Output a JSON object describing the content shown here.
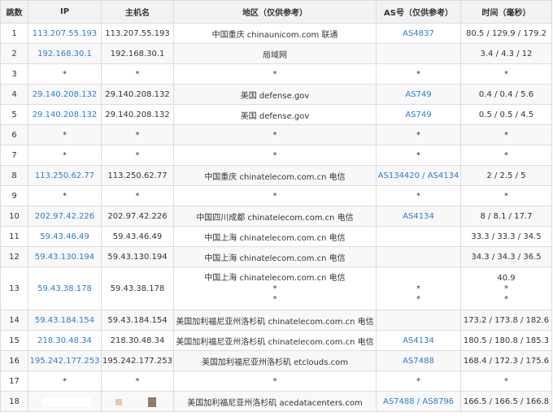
{
  "headers": [
    "跳数",
    "IP",
    "主机名",
    "地区（仅供参考）",
    "AS号（仅供参考）",
    "时间（毫秒）"
  ],
  "rows": [
    {
      "hop": "1",
      "ip": "113.207.55.193",
      "host": "113.207.55.193",
      "region": "中国重庆 chinaunicom.com 联通",
      "as": "AS4837",
      "time": "80.5 / 129.9 / 179.2"
    },
    {
      "hop": "2",
      "ip": "192.168.30.1",
      "host": "192.168.30.1",
      "region": "局域网",
      "as": "",
      "time": "3.4 / 4.3 / 12"
    },
    {
      "hop": "3",
      "ip": "*",
      "host": "*",
      "region": "*",
      "as": "*",
      "time": "*"
    },
    {
      "hop": "4",
      "ip": "29.140.208.132",
      "host": "29.140.208.132",
      "region": "美国 defense.gov",
      "as": "AS749",
      "time": "0.4 / 0.4 / 5.6"
    },
    {
      "hop": "5",
      "ip": "29.140.208.132",
      "host": "29.140.208.132",
      "region": "美国 defense.gov",
      "as": "AS749",
      "time": "0.5 / 0.5 / 4.5"
    },
    {
      "hop": "6",
      "ip": "*",
      "host": "*",
      "region": "*",
      "as": "*",
      "time": "*"
    },
    {
      "hop": "7",
      "ip": "*",
      "host": "*",
      "region": "*",
      "as": "*",
      "time": "*"
    },
    {
      "hop": "8",
      "ip": "113.250.62.77",
      "host": "113.250.62.77",
      "region": "中国重庆 chinatelecom.com.cn 电信",
      "as": "AS134420",
      "as2": "AS4134",
      "time": "2 / 2.5 / 5"
    },
    {
      "hop": "9",
      "ip": "*",
      "host": "*",
      "region": "*",
      "as": "*",
      "time": "*"
    },
    {
      "hop": "10",
      "ip": "202.97.42.226",
      "host": "202.97.42.226",
      "region": "中国四川成都 chinatelecom.com.cn 电信",
      "as": "AS4134",
      "time": "8 / 8.1 / 17.7"
    },
    {
      "hop": "11",
      "ip": "59.43.46.49",
      "host": "59.43.46.49",
      "region": "中国上海 chinatelecom.com.cn 电信",
      "as": "",
      "time": "33.3 / 33.3 / 34.5"
    },
    {
      "hop": "12",
      "ip": "59.43.130.194",
      "host": "59.43.130.194",
      "region": "中国上海 chinatelecom.com.cn 电信",
      "as": "",
      "time": "34.3 / 34.3 / 36.5"
    },
    {
      "hop": "13",
      "ip": "59.43.38.178",
      "host": "59.43.38.178",
      "region_lines": [
        "中国上海 chinatelecom.com.cn 电信",
        "*",
        "*"
      ],
      "as_lines": [
        "",
        "*",
        "*"
      ],
      "time_lines": [
        "40.9",
        "*",
        "*"
      ]
    },
    {
      "hop": "14",
      "ip": "59.43.184.154",
      "host": "59.43.184.154",
      "region": "美国加利福尼亚州洛杉矶 chinatelecom.com.cn 电信",
      "as": "",
      "time": "173.2 / 173.8 / 182.6"
    },
    {
      "hop": "15",
      "ip": "218.30.48.34",
      "host": "218.30.48.34",
      "region": "美国加利福尼亚州洛杉矶 chinatelecom.com.cn 电信",
      "as": "AS4134",
      "time": "180.5 / 180.8 / 185.3"
    },
    {
      "hop": "16",
      "ip": "195.242.177.253",
      "host": "195.242.177.253",
      "region": "美国加利福尼亚州洛杉矶 etclouds.com",
      "as": "AS7488",
      "time": "168.4 / 172.3 / 175.6"
    },
    {
      "hop": "17",
      "ip": "*",
      "host": "*",
      "region": "*",
      "as": "*",
      "time": "*"
    },
    {
      "hop": "18",
      "ip": "",
      "host": "",
      "region": "美国加利福尼亚州洛杉矶 acedatacenters.com",
      "as": "AS7488",
      "as2": "AS8796",
      "time": "166.5 / 166.5 / 166.8"
    }
  ],
  "colors": {
    "link": "#2b7bd0",
    "header_bg": "#f2f2f2",
    "border": "#dcdcdc"
  }
}
